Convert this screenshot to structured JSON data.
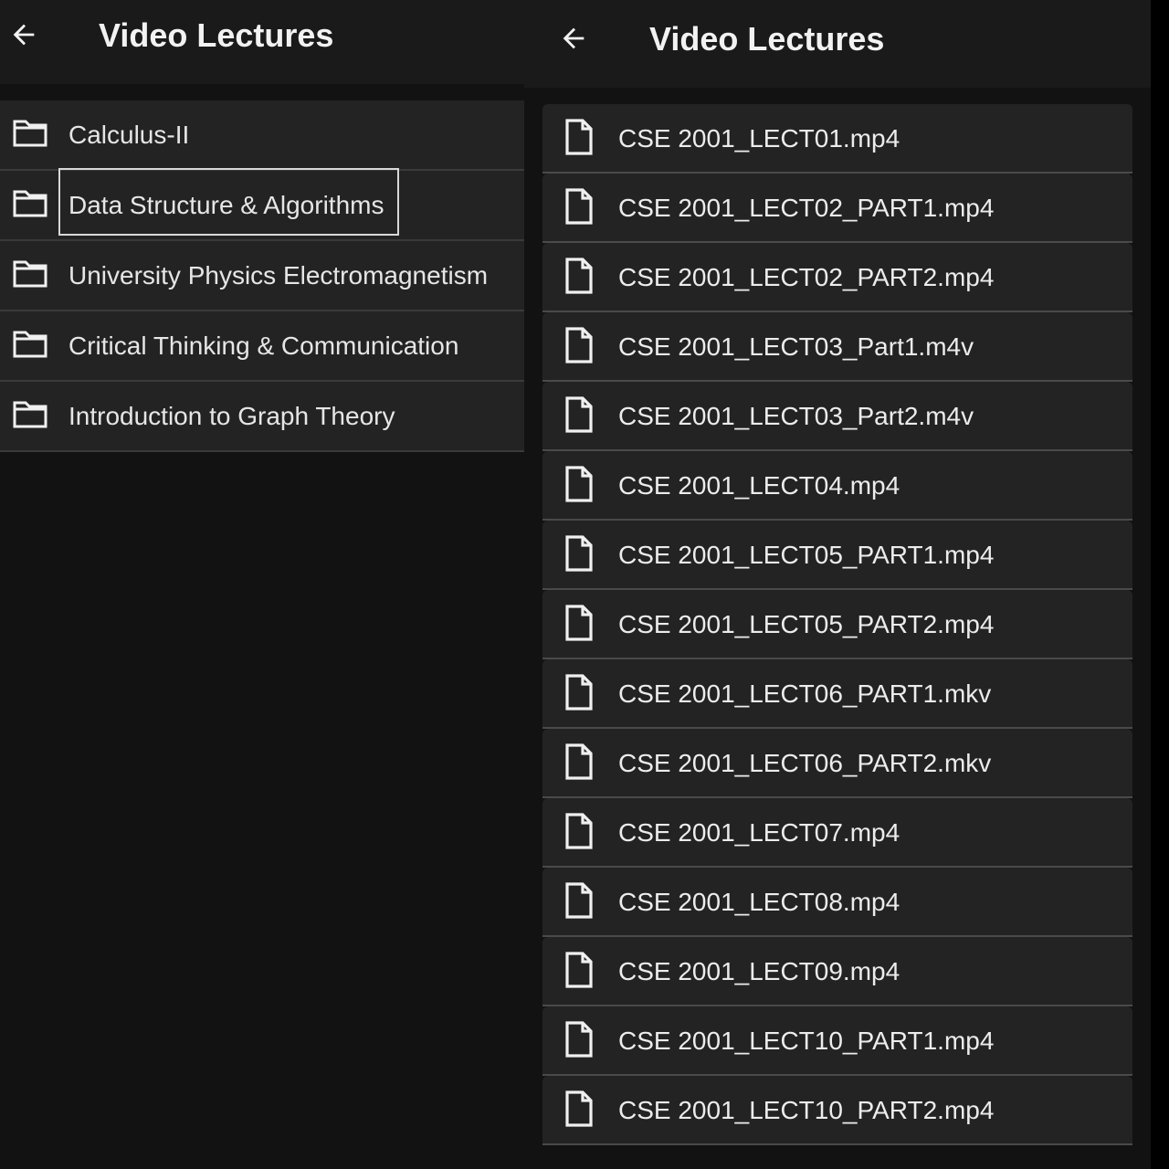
{
  "left_panel": {
    "title": "Video Lectures",
    "back_icon": "arrow-left-icon",
    "folders": [
      {
        "label": "Calculus-II",
        "icon": "folder-icon"
      },
      {
        "label": "Data Structure & Algorithms",
        "icon": "folder-icon",
        "focused": true
      },
      {
        "label": "University Physics Electromagnetism",
        "icon": "folder-icon"
      },
      {
        "label": "Critical Thinking & Communication",
        "icon": "folder-icon"
      },
      {
        "label": "Introduction to Graph Theory",
        "icon": "folder-icon"
      }
    ]
  },
  "right_panel": {
    "title": "Video Lectures",
    "back_icon": "arrow-left-icon",
    "files": [
      {
        "label": "CSE 2001_LECT01.mp4",
        "icon": "file-icon"
      },
      {
        "label": "CSE 2001_LECT02_PART1.mp4",
        "icon": "file-icon"
      },
      {
        "label": "CSE 2001_LECT02_PART2.mp4",
        "icon": "file-icon"
      },
      {
        "label": "CSE 2001_LECT03_Part1.m4v",
        "icon": "file-icon"
      },
      {
        "label": "CSE 2001_LECT03_Part2.m4v",
        "icon": "file-icon"
      },
      {
        "label": "CSE 2001_LECT04.mp4",
        "icon": "file-icon"
      },
      {
        "label": "CSE 2001_LECT05_PART1.mp4",
        "icon": "file-icon"
      },
      {
        "label": "CSE 2001_LECT05_PART2.mp4",
        "icon": "file-icon"
      },
      {
        "label": "CSE 2001_LECT06_PART1.mkv",
        "icon": "file-icon"
      },
      {
        "label": "CSE 2001_LECT06_PART2.mkv",
        "icon": "file-icon"
      },
      {
        "label": "CSE 2001_LECT07.mp4",
        "icon": "file-icon"
      },
      {
        "label": "CSE 2001_LECT08.mp4",
        "icon": "file-icon"
      },
      {
        "label": "CSE 2001_LECT09.mp4",
        "icon": "file-icon"
      },
      {
        "label": "CSE 2001_LECT10_PART1.mp4",
        "icon": "file-icon"
      },
      {
        "label": "CSE 2001_LECT10_PART2.mp4",
        "icon": "file-icon"
      }
    ]
  },
  "colors": {
    "background": "#121212",
    "appbar": "#1a1a1a",
    "row": "#232323",
    "divider": "#3a3a3a",
    "text": "#e8e8e8"
  }
}
